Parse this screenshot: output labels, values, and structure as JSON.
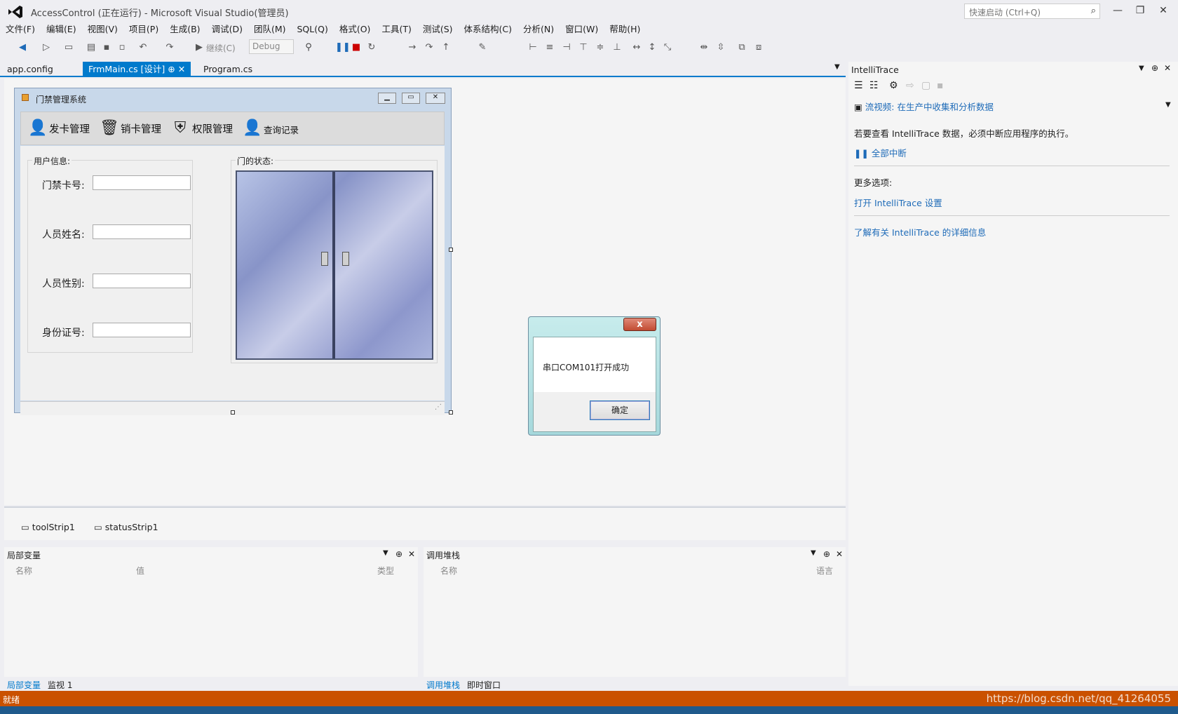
{
  "window": {
    "title": "AccessControl (正在运行) - Microsoft Visual Studio(管理员)",
    "quick_launch": "快速启动 (Ctrl+Q)"
  },
  "menu": [
    "文件(F)",
    "编辑(E)",
    "视图(V)",
    "项目(P)",
    "生成(B)",
    "调试(D)",
    "团队(M)",
    "SQL(Q)",
    "格式(O)",
    "工具(T)",
    "测试(S)",
    "体系结构(C)",
    "分析(N)",
    "窗口(W)",
    "帮助(H)"
  ],
  "toolbar": {
    "continue": "继续(C)",
    "config": "Debug"
  },
  "tabs": [
    {
      "label": "app.config"
    },
    {
      "label": "FrmMain.cs [设计]"
    },
    {
      "label": "Program.cs"
    }
  ],
  "form": {
    "title": "门禁管理系统",
    "buttons": [
      "发卡管理",
      "销卡管理",
      "权限管理",
      "查询记录"
    ],
    "user_group": "用户信息:",
    "door_group": "门的状态:",
    "fields": [
      "门禁卡号:",
      "人员姓名:",
      "人员性别:",
      "身份证号:"
    ]
  },
  "tray": [
    "toolStrip1",
    "statusStrip1"
  ],
  "msgbox": {
    "text": "串口COM101打开成功",
    "ok": "确定",
    "close": "x"
  },
  "locals": {
    "title": "局部变量",
    "cols": [
      "名称",
      "值",
      "类型"
    ],
    "tabs": [
      "局部变量",
      "监视 1"
    ]
  },
  "callstack": {
    "title": "调用堆栈",
    "cols": [
      "名称",
      "语言"
    ],
    "tabs": [
      "调用堆栈",
      "即时窗口"
    ]
  },
  "intellitrace": {
    "title": "IntelliTrace",
    "video": "流视频: 在生产中收集和分析数据",
    "msg": "若要查看 IntelliTrace 数据，必须中断应用程序的执行。",
    "break_all": "全部中断",
    "more": "更多选项:",
    "open_settings": "打开 IntelliTrace 设置",
    "learn": "了解有关 IntelliTrace 的详细信息"
  },
  "status": {
    "text": "就绪",
    "watermark": "https://blog.csdn.net/qq_41264055"
  },
  "colors": {
    "accent": "#007acc",
    "status": "#ca5100"
  }
}
